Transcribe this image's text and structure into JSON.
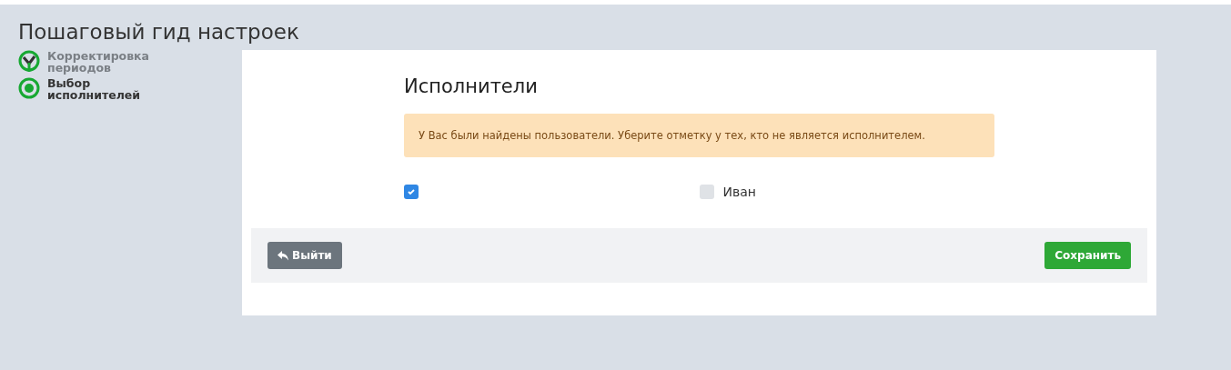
{
  "title": "Пошаговый гид настроек",
  "steps": [
    {
      "label": "Корректировка периодов",
      "completed": true
    },
    {
      "label": "Выбор исполнителей",
      "completed": false
    }
  ],
  "panel": {
    "heading": "Исполнители",
    "alert": "У Вас были найдены пользователи. Уберите отметку у тех, кто не является исполнителем.",
    "users": [
      {
        "checked": true
      },
      {
        "label": "Иван",
        "checked": false
      }
    ],
    "buttons": [
      {
        "label": "Выйти",
        "kind": "exit"
      },
      {
        "label": "Сохранить",
        "kind": "save"
      }
    ]
  }
}
